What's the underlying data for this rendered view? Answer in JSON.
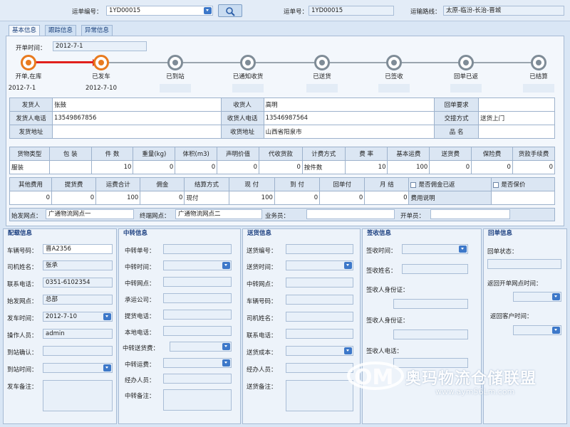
{
  "header": {
    "waybill_no_label": "运单编号：",
    "waybill_no_value": "1YD00015",
    "waybill_no2_label": "运单号：",
    "waybill_no2_value": "1YD00015",
    "route_label": "运输路线：",
    "route_value": "太原-临汾-长治-晋城"
  },
  "tabs": [
    "基本信息",
    "跟踪信息",
    "异常信息"
  ],
  "open_time": {
    "label": "开单时间：",
    "value": "2012-7-1"
  },
  "progress": {
    "completed_steps": 2,
    "steps": [
      {
        "label": "开单,在库",
        "date": "2012-7-1"
      },
      {
        "label": "已发车",
        "date": "2012-7-10"
      },
      {
        "label": "已到站",
        "date": ""
      },
      {
        "label": "已通知收货",
        "date": ""
      },
      {
        "label": "已送货",
        "date": ""
      },
      {
        "label": "已签收",
        "date": ""
      },
      {
        "label": "回单已返",
        "date": ""
      },
      {
        "label": "已结算",
        "date": ""
      }
    ]
  },
  "parties": {
    "shipper_label": "发货人",
    "shipper_value": "张鼓",
    "consignee_label": "收货人",
    "consignee_value": "高明",
    "receipt_req_label": "回单要求",
    "receipt_req_value": "",
    "shipper_phone_label": "发货人电话",
    "shipper_phone_value": "13549867856",
    "consignee_phone_label": "收货人电话",
    "consignee_phone_value": "13546987564",
    "handover_label": "交接方式",
    "handover_value": "送货上门",
    "shipper_addr_label": "发货地址",
    "shipper_addr_value": "",
    "consignee_addr_label": "收货地址",
    "consignee_addr_value": "山西省阳泉市",
    "goods_name_label": "品  名",
    "goods_name_value": ""
  },
  "goods_table": {
    "headers": [
      "货物类型",
      "包  装",
      "件  数",
      "重量(kg)",
      "体积(m3)",
      "声明价值",
      "代收货款",
      "计费方式",
      "费  率",
      "基本运费",
      "送货费",
      "保险费",
      "货款手续费"
    ],
    "values": [
      "服装",
      "",
      "10",
      "0",
      "0",
      "0",
      "0",
      "按件数",
      "10",
      "100",
      "0",
      "0",
      "0"
    ]
  },
  "fee_table": {
    "headers": [
      "其他费用",
      "提货费",
      "运费合计",
      "佣金",
      "结算方式",
      "现  付",
      "到  付",
      "回单付",
      "月  结"
    ],
    "values": [
      "0",
      "0",
      "100",
      "0",
      "现付",
      "100",
      "0",
      "0",
      "0"
    ],
    "check1": "是否佣金已返",
    "check2": "是否保价",
    "fee_note": "费用说明"
  },
  "stations": {
    "origin_label": "始发网点：",
    "origin_value": "广通物流网点一",
    "dest_label": "终端网点：",
    "dest_value": "广通物流网点二",
    "salesman_label": "业务员：",
    "salesman_value": "",
    "opener_label": "开单员：",
    "opener_value": ""
  },
  "panel_dispatch": {
    "title": "配载信息",
    "rows": [
      {
        "label": "车辆号码：",
        "value": "晋A2356"
      },
      {
        "label": "司机姓名：",
        "value": "张承"
      },
      {
        "label": "联系电话：",
        "value": "0351-6102354"
      },
      {
        "label": "始发网点：",
        "value": "总部"
      },
      {
        "label": "发车时间：",
        "value": "2012-7-10"
      },
      {
        "label": "操作人员：",
        "value": "admin"
      },
      {
        "label": "到站确认：",
        "value": ""
      },
      {
        "label": "到站时间：",
        "value": ""
      },
      {
        "label": "发车备注：",
        "value": ""
      }
    ]
  },
  "panel_transfer": {
    "title": "中转信息",
    "rows": [
      {
        "label": "中转单号："
      },
      {
        "label": "中转时间："
      },
      {
        "label": "中转网点："
      },
      {
        "label": "承运公司："
      },
      {
        "label": "提货电话："
      },
      {
        "label": "本地电话："
      },
      {
        "label": "中转送货费："
      },
      {
        "label": "中转运费："
      },
      {
        "label": "经办人员："
      },
      {
        "label": "中转备注："
      }
    ]
  },
  "panel_delivery": {
    "title": "送货信息",
    "rows": [
      {
        "label": "送货编号："
      },
      {
        "label": "送货时间："
      },
      {
        "label": "中转网点："
      },
      {
        "label": "车辆号码："
      },
      {
        "label": "司机姓名："
      },
      {
        "label": "联系电话："
      },
      {
        "label": "送货成本："
      },
      {
        "label": "经办人员："
      },
      {
        "label": "送货备注："
      }
    ]
  },
  "panel_sign": {
    "title": "签收信息",
    "rows": [
      {
        "label": "签收时间："
      },
      {
        "label": "签收姓名："
      },
      {
        "label": "签收人身份证："
      },
      {
        "label": "签收人身份证："
      },
      {
        "label": "签收人电话："
      }
    ]
  },
  "panel_receipt": {
    "title": "回单信息",
    "rows": [
      {
        "label": "回单状态："
      },
      {
        "label": "返回开单网点时间："
      },
      {
        "label": "返回客户时间："
      }
    ]
  },
  "watermark": {
    "text": "奥玛物流仓储联盟",
    "url": "www.aym56Lm.com"
  },
  "colors": {
    "accent_orange": "#e87a1f",
    "arrow_red": "#e0201c",
    "step_gray": "#7f8c97",
    "dropdown_blue": "#3d78c9"
  }
}
